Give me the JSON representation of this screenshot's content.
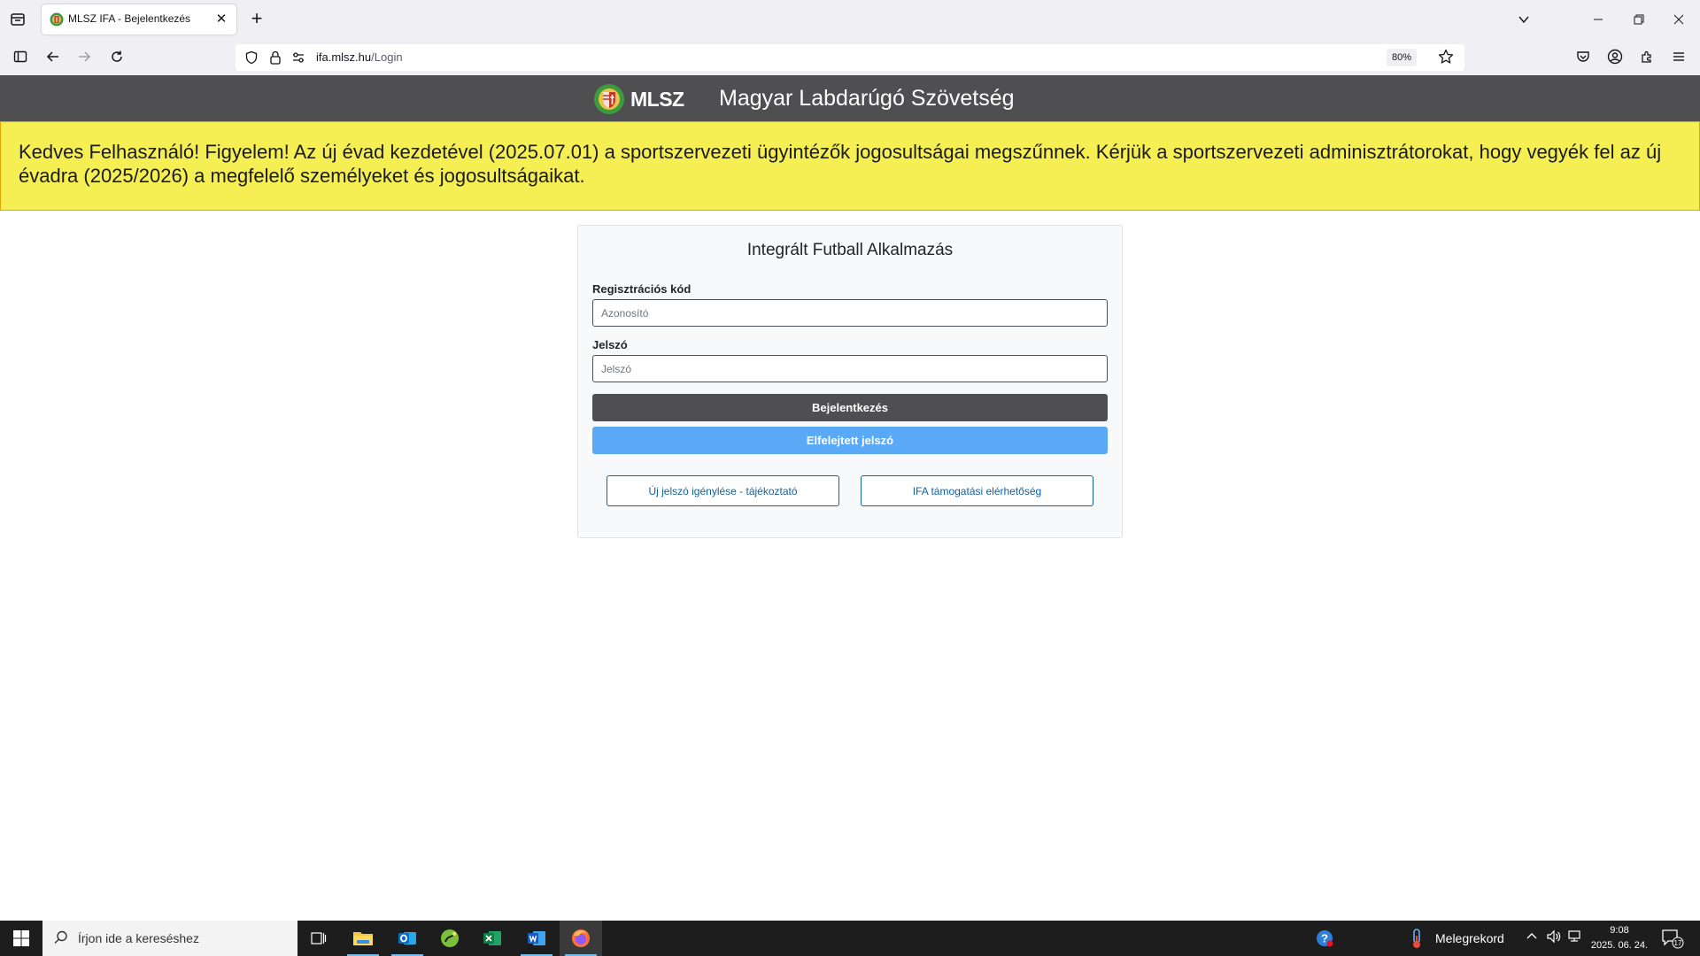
{
  "browser": {
    "tab_title": "MLSZ IFA - Bejelentkezés",
    "url_domain": "ifa.mlsz.hu",
    "url_path": "/Login",
    "zoom": "80%",
    "icons": [
      "tab-list-icon",
      "close-icon",
      "plus-icon",
      "chevron-down-icon",
      "minimize-icon",
      "restore-icon",
      "sidebar-icon",
      "back-icon",
      "forward-icon",
      "reload-icon",
      "shield-icon",
      "lock-icon",
      "permissions-icon",
      "star-icon",
      "pocket-icon",
      "account-icon",
      "extensions-icon",
      "menu-icon"
    ]
  },
  "header": {
    "logo_text": "MLSZ",
    "federation_name": "Magyar Labdarúgó Szövetség"
  },
  "alert": {
    "message": "Kedves Felhasználó! Figyelem! Az új évad kezdetével (2025.07.01) a sportszervezeti ügyintézők jogosultságai megszűnnek. Kérjük a sportszervezeti adminisztrátorokat, hogy vegyék fel az új évadra (2025/2026) a megfelelő személyeket és jogosultságaikat."
  },
  "login": {
    "title": "Integrált Futball Alkalmazás",
    "code_label": "Regisztrációs kód",
    "code_placeholder": "Azonosító",
    "code_value": "",
    "password_label": "Jelszó",
    "password_placeholder": "Jelszó",
    "password_value": "",
    "login_button": "Bejelentkezés",
    "forgot_button": "Elfelejtett jelszó",
    "new_password_info": "Új jelszó igénylése - tájékoztató",
    "support_contact": "IFA támogatási elérhetőség"
  },
  "colors": {
    "header_bg": "#4f4e50",
    "alert_bg": "#f5ef54",
    "login_button_bg": "#4f4e50",
    "forgot_button_bg": "#59a9f6",
    "outline_button": "#1261a0"
  },
  "taskbar": {
    "search_placeholder": "Írjon ide a kereséshez",
    "weather": "Melegrekord",
    "time": "9:08",
    "date": "2025. 06. 24.",
    "notification_count": "17",
    "apps": [
      "file-explorer-icon",
      "outlook-icon",
      "maps-icon",
      "excel-icon",
      "word-icon",
      "firefox-icon"
    ]
  }
}
